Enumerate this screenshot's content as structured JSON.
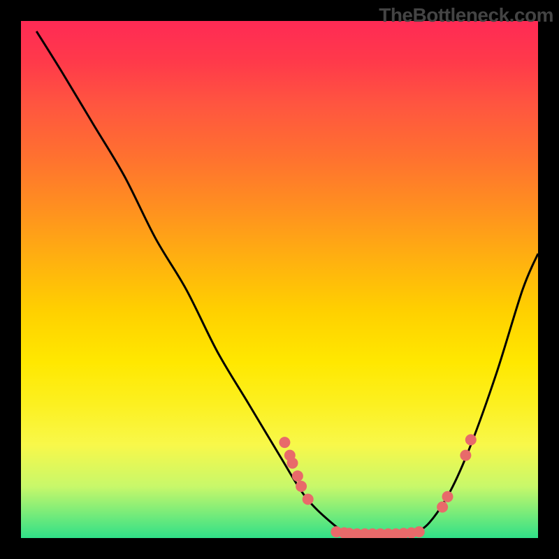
{
  "watermark": "TheBottleneck.com",
  "chart_data": {
    "type": "line",
    "title": "",
    "xlabel": "",
    "ylabel": "",
    "xlim": [
      0,
      100
    ],
    "ylim": [
      0,
      100
    ],
    "curve": [
      {
        "x": 3,
        "y": 98
      },
      {
        "x": 8,
        "y": 90
      },
      {
        "x": 14,
        "y": 80
      },
      {
        "x": 20,
        "y": 70
      },
      {
        "x": 26,
        "y": 58
      },
      {
        "x": 32,
        "y": 48
      },
      {
        "x": 38,
        "y": 36
      },
      {
        "x": 44,
        "y": 26
      },
      {
        "x": 50,
        "y": 16
      },
      {
        "x": 55,
        "y": 8
      },
      {
        "x": 60,
        "y": 3
      },
      {
        "x": 63,
        "y": 1
      },
      {
        "x": 66,
        "y": 0.5
      },
      {
        "x": 70,
        "y": 0.5
      },
      {
        "x": 73,
        "y": 0.5
      },
      {
        "x": 76,
        "y": 1
      },
      {
        "x": 79,
        "y": 3
      },
      {
        "x": 83,
        "y": 9
      },
      {
        "x": 87,
        "y": 18
      },
      {
        "x": 92,
        "y": 32
      },
      {
        "x": 97,
        "y": 48
      },
      {
        "x": 100,
        "y": 55
      }
    ],
    "points": [
      {
        "x": 51,
        "y": 18.5
      },
      {
        "x": 52,
        "y": 16
      },
      {
        "x": 52.5,
        "y": 14.5
      },
      {
        "x": 53.5,
        "y": 12
      },
      {
        "x": 54.2,
        "y": 10
      },
      {
        "x": 55.5,
        "y": 7.5
      },
      {
        "x": 61,
        "y": 1.2
      },
      {
        "x": 62.5,
        "y": 1.0
      },
      {
        "x": 63.5,
        "y": 0.9
      },
      {
        "x": 65,
        "y": 0.8
      },
      {
        "x": 66.5,
        "y": 0.8
      },
      {
        "x": 68,
        "y": 0.8
      },
      {
        "x": 69.5,
        "y": 0.8
      },
      {
        "x": 71,
        "y": 0.8
      },
      {
        "x": 72.5,
        "y": 0.8
      },
      {
        "x": 74,
        "y": 0.9
      },
      {
        "x": 75.5,
        "y": 1.0
      },
      {
        "x": 77,
        "y": 1.2
      },
      {
        "x": 81.5,
        "y": 6
      },
      {
        "x": 82.5,
        "y": 8
      },
      {
        "x": 86,
        "y": 16
      },
      {
        "x": 87,
        "y": 19
      }
    ],
    "point_color": "#e86a6a",
    "curve_color": "#000000"
  }
}
